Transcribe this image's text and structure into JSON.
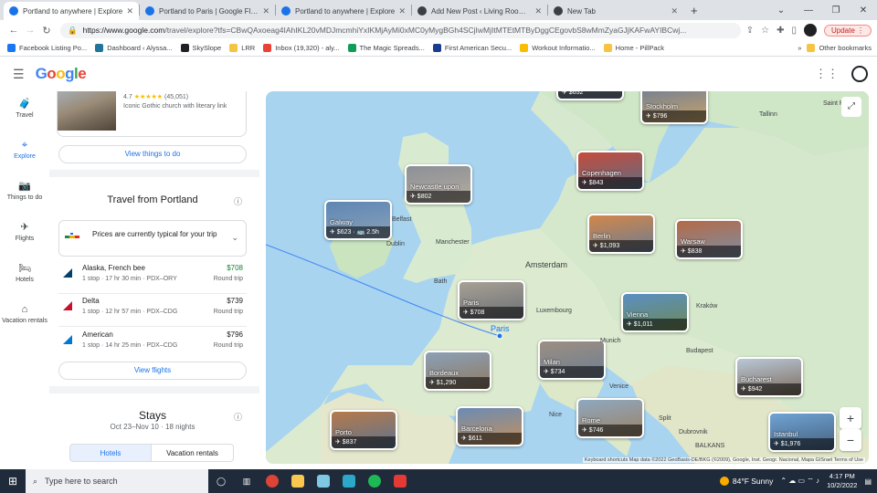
{
  "browser": {
    "tabs": [
      {
        "title": "Portland to anywhere | Explore",
        "active": true,
        "color": "#1a73e8"
      },
      {
        "title": "Portland to Paris | Google Flights",
        "active": false,
        "color": "#1a73e8"
      },
      {
        "title": "Portland to anywhere | Explore",
        "active": false,
        "color": "#1a73e8"
      },
      {
        "title": "Add New Post ‹ Living Room Re...",
        "active": false,
        "color": "#3c4043"
      },
      {
        "title": "New Tab",
        "active": false,
        "color": "#3c4043"
      }
    ],
    "new_tab_icon": "plus",
    "url_host": "https://www.google.com",
    "url_path": "/travel/explore?tfs=CBwQAxoeag4IAhIKL20vMDJmcmhiYxIKMjAyMi0xMC0yMygBGh4SCjIwMjItMTEtMTByDggCEgovbS8wMmZyaGJjKAFwAYIBCwj...",
    "update_label": "Update",
    "bookmarks": [
      {
        "label": "Facebook Listing Po...",
        "color": "#1877f2"
      },
      {
        "label": "Dashboard ‹ Alyssa...",
        "color": "#21759b"
      },
      {
        "label": "SkySlope",
        "color": "#202124"
      },
      {
        "label": "LRR",
        "color": "#f6c342"
      },
      {
        "label": "Inbox (19,320) - aly...",
        "color": "#ea4335"
      },
      {
        "label": "The Magic Spreads...",
        "color": "#0f9d58"
      },
      {
        "label": "First American Secu...",
        "color": "#1a3d8f"
      },
      {
        "label": "Workout Informatio...",
        "color": "#fbbc04"
      },
      {
        "label": "Home - PillPack",
        "color": "#f6c342"
      }
    ],
    "other_bookmarks": "Other bookmarks"
  },
  "google": {
    "logo": [
      "G",
      "o",
      "o",
      "g",
      "l",
      "e"
    ]
  },
  "rail": [
    {
      "label": "Travel",
      "icon": "suitcase-icon",
      "glyph": "🧳",
      "active": false
    },
    {
      "label": "Explore",
      "icon": "explore-icon",
      "glyph": "⌖",
      "active": true
    },
    {
      "label": "Things to do",
      "icon": "camera-icon",
      "glyph": "📷",
      "active": false
    },
    {
      "label": "Flights",
      "icon": "plane-icon",
      "glyph": "✈",
      "active": false
    },
    {
      "label": "Hotels",
      "icon": "bed-icon",
      "glyph": "🛏",
      "active": false
    },
    {
      "label": "Vacation rentals",
      "icon": "house-icon",
      "glyph": "⌂",
      "active": false
    }
  ],
  "attraction": {
    "rating": "4.7",
    "stars": "★★★★★",
    "reviews": "(45,051)",
    "description": "Iconic Gothic church with literary link",
    "view_things_label": "View things to do"
  },
  "travel": {
    "title": "Travel from Portland",
    "price_note": "Prices are currently typical for your trip",
    "flights": [
      {
        "airline": "Alaska, French bee",
        "details": "1 stop · 17 hr 30 min · PDX–ORY",
        "price": "$708",
        "trip": "Round trip",
        "low": true,
        "color": "#01426a"
      },
      {
        "airline": "Delta",
        "details": "1 stop · 12 hr 57 min · PDX–CDG",
        "price": "$739",
        "trip": "Round trip",
        "low": false,
        "color": "#c8102e"
      },
      {
        "airline": "American",
        "details": "1 stop · 14 hr 25 min · PDX–CDG",
        "price": "$796",
        "trip": "Round trip",
        "low": false,
        "color": "#0078d2"
      }
    ],
    "view_flights_label": "View flights"
  },
  "stays": {
    "title": "Stays",
    "dates": "Oct 23–Nov 10 · 18 nights",
    "tabs": [
      "Hotels",
      "Vacation rentals"
    ]
  },
  "map": {
    "destinations": [
      {
        "name": "Stockholm",
        "price": "✈ $796"
      },
      {
        "name": "Copenhagen",
        "price": "✈ $843"
      },
      {
        "name": "Newcastle upon Tyne",
        "price": "✈ $802"
      },
      {
        "name": "Galway",
        "price": "✈ $623 · 🚌 2.5h"
      },
      {
        "name": "Berlin",
        "price": "✈ $1,093"
      },
      {
        "name": "Warsaw",
        "price": "✈ $838"
      },
      {
        "name": "Paris",
        "price": "✈ $708"
      },
      {
        "name": "Vienna",
        "price": "✈ $1,011"
      },
      {
        "name": "Milan",
        "price": "✈ $734"
      },
      {
        "name": "Bordeaux",
        "price": "✈ $1,290"
      },
      {
        "name": "Bucharest",
        "price": "✈ $942"
      },
      {
        "name": "Porto",
        "price": "✈ $837"
      },
      {
        "name": "Barcelona",
        "price": "✈ $611"
      },
      {
        "name": "Rome",
        "price": "✈ $746"
      },
      {
        "name": "Istanbul",
        "price": "✈ $1,976"
      }
    ],
    "places": {
      "amsterdam": "Amsterdam",
      "paris": "Paris",
      "tallinn": "Tallinn",
      "saint_p": "Saint P",
      "belfast": "Belfast",
      "dublin": "Dublin",
      "manchester": "Manchester",
      "bath": "Bath",
      "luxembourg": "Luxembourg",
      "krakow": "Kraków",
      "munich": "Munich",
      "budapest": "Budapest",
      "venice": "Venice",
      "nice": "Nice",
      "split": "Split",
      "dubrovnik": "Dubrovnik",
      "balkans": "BALKANS",
      "top_price": "✈ $652"
    },
    "zoom_in": "+",
    "zoom_out": "−",
    "attribution": "Keyboard shortcuts   Map data ©2022 GeoBasis-DE/BKG (©2009), Google, Inst. Geogr. Nacional, Mapa GISrael   Terms of Use"
  },
  "taskbar": {
    "search_placeholder": "Type here to search",
    "weather": "84°F  Sunny",
    "time": "4:17 PM",
    "date": "10/2/2022"
  }
}
